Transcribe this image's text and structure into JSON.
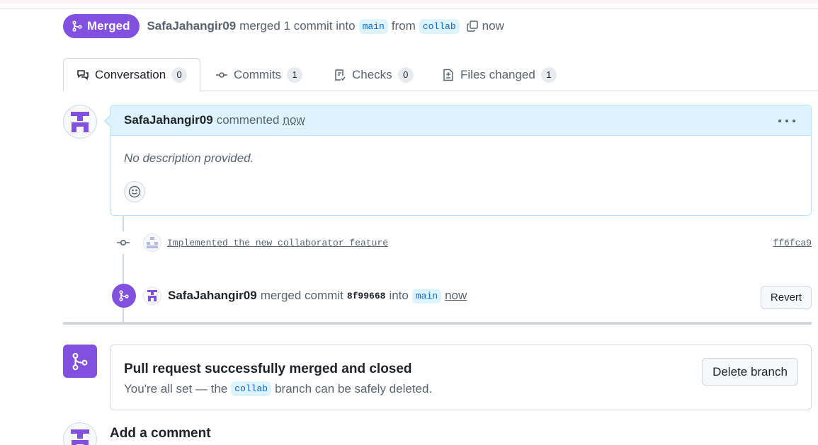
{
  "header": {
    "state_label": "Merged",
    "author": "SafaJahangir09",
    "merged_text": "merged 1 commit into",
    "base_branch": "main",
    "from_text": "from",
    "head_branch": "collab",
    "time": "now"
  },
  "tabs": [
    {
      "label": "Conversation",
      "count": "0"
    },
    {
      "label": "Commits",
      "count": "1"
    },
    {
      "label": "Checks",
      "count": "0"
    },
    {
      "label": "Files changed",
      "count": "1"
    }
  ],
  "comment": {
    "author": "SafaJahangir09",
    "action": "commented",
    "time": "now",
    "body": "No description provided."
  },
  "commit": {
    "message": "Implemented the new collaborator feature",
    "sha": "ff6fca9"
  },
  "merge_event": {
    "author": "SafaJahangir09",
    "text_before": "merged commit",
    "sha": "8f99668",
    "into_text": "into",
    "branch": "main",
    "time": "now",
    "revert_label": "Revert"
  },
  "merge_box": {
    "title": "Pull request successfully merged and closed",
    "subtitle_before": "You're all set — the",
    "branch": "collab",
    "subtitle_after": "branch can be safely deleted.",
    "delete_label": "Delete branch"
  },
  "add_comment": {
    "title": "Add a comment"
  },
  "colors": {
    "merged_purple": "#8250df",
    "comment_header_bg": "#ddf4ff",
    "branch_pill_bg": "#ddf4ff",
    "branch_pill_text": "#0969da"
  }
}
